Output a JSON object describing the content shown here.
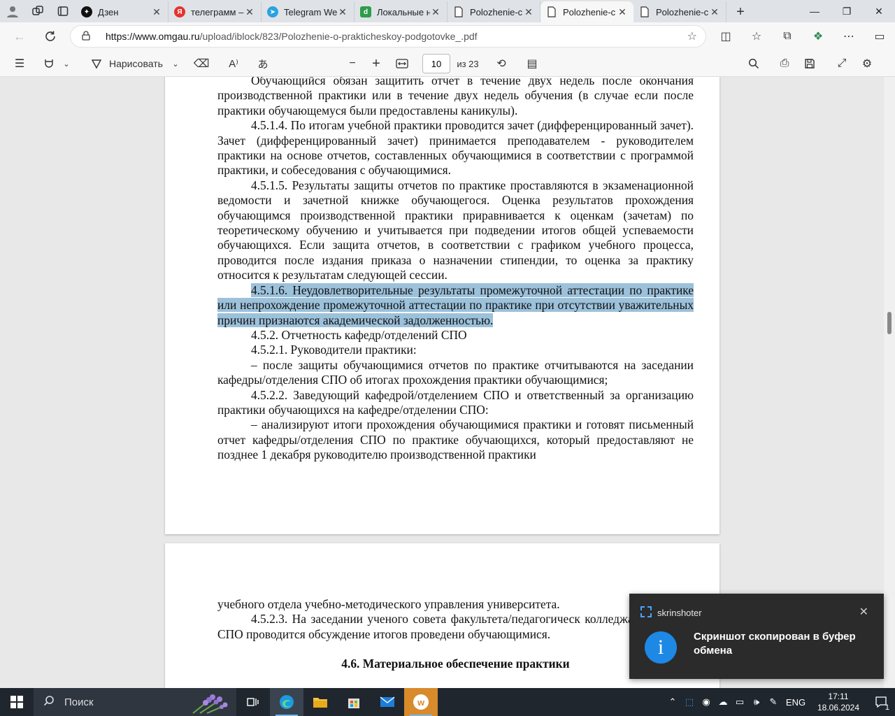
{
  "browser": {
    "tabs": [
      {
        "title": "Дзен",
        "favicon_color": "#111111",
        "favicon_glyph": "✦"
      },
      {
        "title": "телеграмм –",
        "favicon_color": "#e5322d",
        "favicon_glyph": "Я"
      },
      {
        "title": "Telegram We",
        "favicon_color": "#2aa3de",
        "favicon_glyph": "➤"
      },
      {
        "title": "Локальные н",
        "favicon_color": "#2e9c4a",
        "favicon_glyph": "d"
      },
      {
        "title": "Polozhenie-c",
        "favicon_color": "#ffffff",
        "favicon_glyph": ""
      },
      {
        "title": "Polozhenie-c",
        "favicon_color": "#ffffff",
        "favicon_glyph": "",
        "active": true
      },
      {
        "title": "Polozhenie-c",
        "favicon_color": "#ffffff",
        "favicon_glyph": ""
      }
    ],
    "url_host": "https://www.omgau.ru",
    "url_path": "/upload/iblock/823/Polozhenie-o-prakticheskoy-podgotovke_.pdf"
  },
  "pdf_toolbar": {
    "draw_label": "Нарисовать",
    "page_current": "10",
    "page_total": "из 23"
  },
  "page1": {
    "p1": "Обучающийся обязан защитить отчет в течение двух недель после окончания производственной практики или в течение двух недель обучения (в случае если после практики обучающемуся были предоставлены каникулы).",
    "p2": "4.5.1.4. По итогам учебной практики проводится зачет (дифференцированный зачет). Зачет (дифференцированный зачет) принимается преподавателем - руководителем практики на основе отчетов, составленных обучающимися в соответствии с программой практики, и собеседования с обучающимися.",
    "p3": "4.5.1.5. Результаты защиты отчетов по практике проставляются в экзаменационной ведомости и зачетной книжке обучающегося. Оценка результатов прохождения обучающимся производственной практики приравнивается к оценкам (зачетам) по теоретическому обучению и учитывается при подведении итогов общей успеваемости обучающихся. Если защита отчетов, в соответствии с графиком учебного процесса, проводится после издания приказа о назначении стипендии, то оценка за практику относится к результатам следующей сессии.",
    "p4_highlighted": "4.5.1.6. Неудовлетворительные результаты промежуточной аттестации по практике или непрохождение промежуточной аттестации по практике при отсутствии уважительных причин признаются академической задолженностью.",
    "p5": "4.5.2. Отчетность кафедр/отделений СПО",
    "p6": "4.5.2.1. Руководители практики:",
    "p7": "– после защиты обучающимися отчетов по практике отчитываются на заседании кафедры/отделения СПО об итогах прохождения практики обучающимися;",
    "p8": "4.5.2.2. Заведующий кафедрой/отделением СПО и ответственный за организацию практики обучающихся на кафедре/отделении СПО:",
    "p9": "– анализируют итоги прохождения обучающимися практики и готовят письменный отчет кафедры/отделения СПО по практике обучающихся, который предоставляют  не позднее 1 декабря руководителю производственной практики"
  },
  "page2": {
    "p1": "учебного отдела учебно-методического управления университета.",
    "p2": "4.5.2.3. На заседании ученого совета факультета/педагогическ колледжа, отделения СПО проводится обсуждение итогов проведени обучающимися.",
    "heading": "4.6. Материальное обеспечение практики"
  },
  "toast": {
    "app_name": "skrinshoter",
    "message": "Скриншот скопирован в буфер обмена"
  },
  "taskbar": {
    "search_label": "Поиск",
    "lang": "ENG",
    "time": "17:11",
    "date": "18.06.2024",
    "notif_count": "1"
  }
}
